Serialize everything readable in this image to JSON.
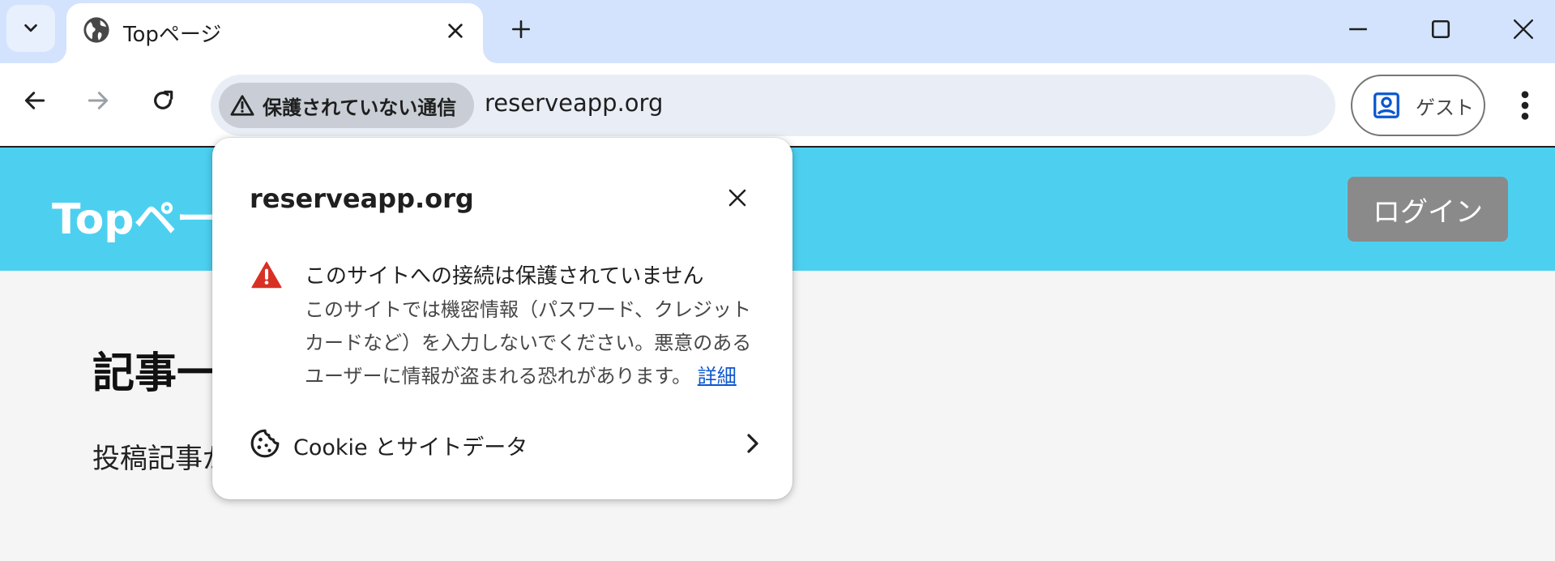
{
  "browser": {
    "tab": {
      "title": "Topページ",
      "favicon": "globe-icon"
    },
    "omnibox": {
      "security_chip": "保護されていない通信",
      "url": "reserveapp.org"
    },
    "profile": {
      "label": "ゲスト"
    }
  },
  "page": {
    "header": {
      "title": "Topページ",
      "login_button": "ログイン"
    },
    "main": {
      "heading": "記事一覧",
      "text": "投稿記事がありません"
    }
  },
  "popup": {
    "host": "reserveapp.org",
    "warning_title": "このサイトへの接続は保護されていません",
    "warning_body": "このサイトでは機密情報（パスワード、クレジット カードなど）を入力しないでください。悪意のあるユーザーに情報が盗まれる恐れがあります。",
    "details_link": "詳細",
    "cookie_label": "Cookie とサイトデータ"
  },
  "colors": {
    "tabstrip": "#d3e3fd",
    "omnibox": "#e9eef6",
    "site_header": "#4dd0f0",
    "login_button": "#8a8a8a",
    "warning": "#d93025",
    "link": "#0b57d0"
  }
}
